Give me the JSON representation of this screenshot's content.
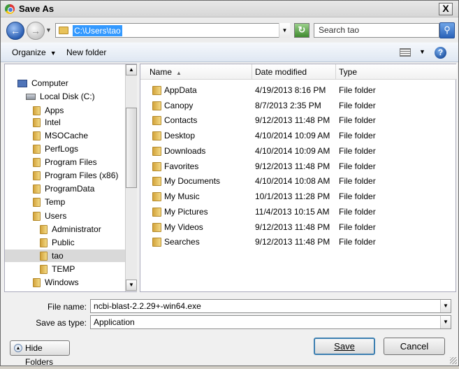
{
  "window": {
    "title": "Save As",
    "close_label": "X"
  },
  "navbar": {
    "address": "C:\\Users\\tao",
    "search_placeholder": "Search tao"
  },
  "toolbar": {
    "organize": "Organize",
    "new_folder": "New folder",
    "help": "?"
  },
  "tree": {
    "items": [
      {
        "label": "Computer",
        "icon": "computer-icon",
        "level": 0
      },
      {
        "label": "Local Disk (C:)",
        "icon": "disk-icon",
        "level": 1
      },
      {
        "label": "Apps",
        "icon": "folder-icon",
        "level": 2
      },
      {
        "label": "Intel",
        "icon": "folder-icon",
        "level": 2
      },
      {
        "label": "MSOCache",
        "icon": "folder-icon",
        "level": 2
      },
      {
        "label": "PerfLogs",
        "icon": "folder-icon",
        "level": 2
      },
      {
        "label": "Program Files",
        "icon": "folder-icon",
        "level": 2
      },
      {
        "label": "Program Files (x86)",
        "icon": "folder-icon",
        "level": 2
      },
      {
        "label": "ProgramData",
        "icon": "folder-icon",
        "level": 2
      },
      {
        "label": "Temp",
        "icon": "folder-icon",
        "level": 2
      },
      {
        "label": "Users",
        "icon": "folder-icon",
        "level": 2
      },
      {
        "label": "Administrator",
        "icon": "folder-icon",
        "level": 3
      },
      {
        "label": "Public",
        "icon": "folder-icon",
        "level": 3
      },
      {
        "label": "tao",
        "icon": "folder-icon",
        "level": 3,
        "selected": true
      },
      {
        "label": "TEMP",
        "icon": "folder-icon",
        "level": 3
      },
      {
        "label": "Windows",
        "icon": "folder-icon",
        "level": 2
      }
    ]
  },
  "files": {
    "columns": {
      "name": "Name",
      "date": "Date modified",
      "type": "Type"
    },
    "rows": [
      {
        "name": "AppData",
        "date": "4/19/2013 8:16 PM",
        "type": "File folder"
      },
      {
        "name": "Canopy",
        "date": "8/7/2013 2:35 PM",
        "type": "File folder"
      },
      {
        "name": "Contacts",
        "date": "9/12/2013 11:48 PM",
        "type": "File folder"
      },
      {
        "name": "Desktop",
        "date": "4/10/2014 10:09 AM",
        "type": "File folder"
      },
      {
        "name": "Downloads",
        "date": "4/10/2014 10:09 AM",
        "type": "File folder"
      },
      {
        "name": "Favorites",
        "date": "9/12/2013 11:48 PM",
        "type": "File folder"
      },
      {
        "name": "My Documents",
        "date": "4/10/2014 10:08 AM",
        "type": "File folder"
      },
      {
        "name": "My Music",
        "date": "10/1/2013 11:28 PM",
        "type": "File folder"
      },
      {
        "name": "My Pictures",
        "date": "11/4/2013 10:15 AM",
        "type": "File folder"
      },
      {
        "name": "My Videos",
        "date": "9/12/2013 11:48 PM",
        "type": "File folder"
      },
      {
        "name": "Searches",
        "date": "9/12/2013 11:48 PM",
        "type": "File folder"
      }
    ]
  },
  "bottom": {
    "file_name_label": "File name:",
    "file_name_value": "ncbi-blast-2.2.29+-win64.exe",
    "save_type_label": "Save as type:",
    "save_type_value": "Application",
    "hide_folders": "Hide Folders",
    "save": "Save",
    "cancel": "Cancel"
  }
}
